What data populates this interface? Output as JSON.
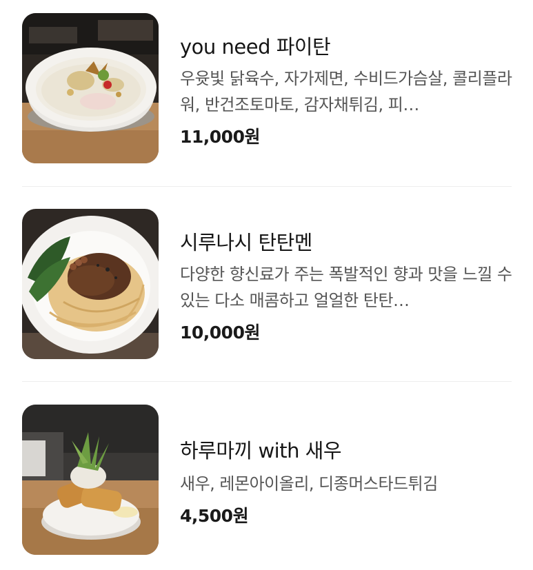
{
  "menu": {
    "items": [
      {
        "name": "you need 파이탄",
        "description": "우윳빛 닭육수, 자가제면, 수비드가슴살, 콜리플라워, 반건조토마토, 감자채튀김, 피…",
        "price": "11,000원",
        "image_icon": "paitan-ramen-bowl"
      },
      {
        "name": "시루나시 탄탄멘",
        "description": "다양한 향신료가 주는 폭발적인 향과 맛을 느낄 수 있는 다소 매콤하고 얼얼한 탄탄…",
        "price": "10,000원",
        "image_icon": "dry-tantanmen-bowl"
      },
      {
        "name": "하루마끼 with 새우",
        "description": "새우, 레몬아이올리, 디종머스타드튀김",
        "price": "4,500원",
        "image_icon": "harumaki-shrimp-plate"
      }
    ]
  }
}
